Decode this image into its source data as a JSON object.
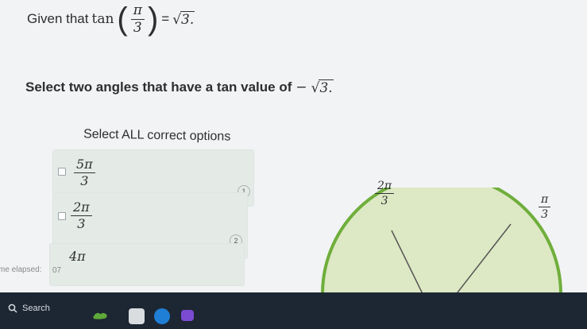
{
  "given": {
    "prefix": "Given that",
    "func": "tan",
    "arg_num": "π",
    "arg_den": "3",
    "equals": "=",
    "radical": "√",
    "rad_value": "3."
  },
  "question": {
    "text": "Select two angles that have a tan value of",
    "sign": "−",
    "radical": "√",
    "rad_value": "3."
  },
  "instruction": "Select ALL correct options",
  "options": [
    {
      "num": "5π",
      "den": "3",
      "badge": "1"
    },
    {
      "num": "2π",
      "den": "3",
      "badge": "2"
    },
    {
      "num": "4π",
      "den": "",
      "badge": ""
    }
  ],
  "unit_circle": {
    "angles": [
      {
        "num": "2π",
        "den": "3"
      },
      {
        "num": "π",
        "den": "3"
      }
    ],
    "fill_color": "#dde8c4",
    "stroke_color": "#6fae3b"
  },
  "elapsed": {
    "label": "me elapsed:",
    "value": "07"
  },
  "taskbar": {
    "search_label": "Search"
  }
}
